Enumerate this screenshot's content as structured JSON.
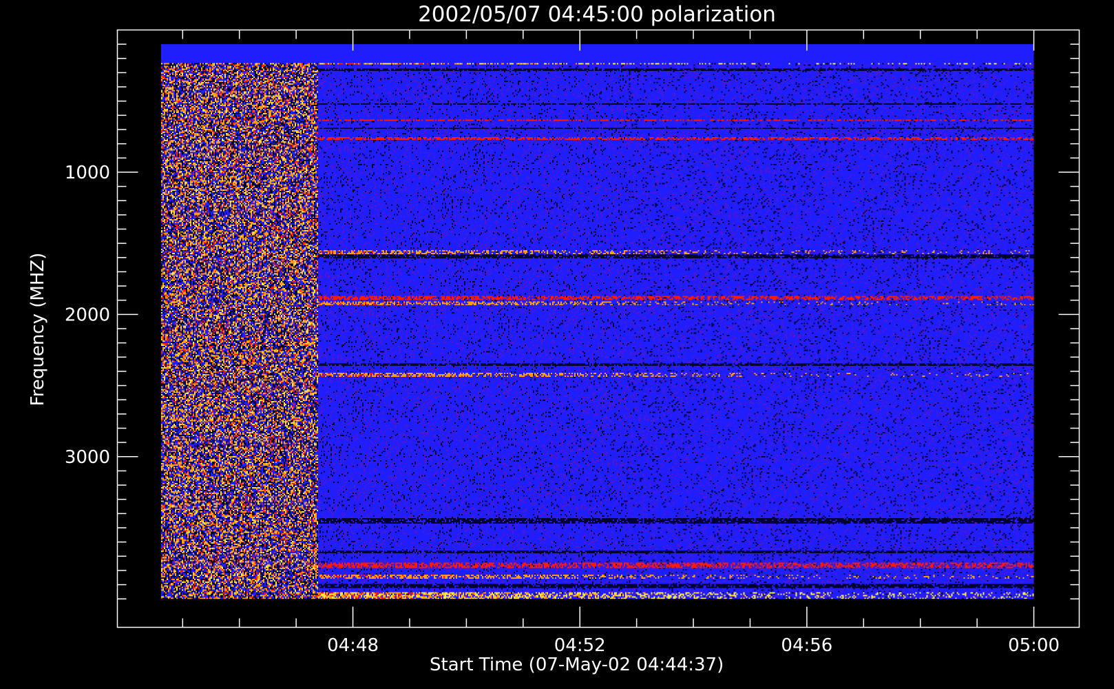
{
  "chart_data": {
    "type": "heatmap",
    "title": "2002/05/07 04:45:00 polarization",
    "xlabel": "Start Time (07-May-02 04:44:37)",
    "ylabel": "Frequency (MHZ)",
    "x_tick_labels": [
      "04:48",
      "04:52",
      "04:56",
      "05:00"
    ],
    "x_tick_values_min": [
      48,
      52,
      56,
      60
    ],
    "x_minor_step_min": 1,
    "x_range_min": [
      44.62,
      60.0
    ],
    "xlim_min": [
      43.85,
      60.8
    ],
    "y_tick_labels": [
      "1000",
      "2000",
      "3000"
    ],
    "y_tick_values": [
      1000,
      2000,
      3000
    ],
    "y_minor_step": 100,
    "y_range": [
      100,
      4000
    ],
    "ylim": [
      4200,
      0
    ],
    "colors": {
      "background": "#000000",
      "frame": "#ffffff",
      "base": "#1e1eff",
      "dark": "#000032",
      "red": "#ff1a00",
      "orange": "#ff9c1a",
      "yellow": "#ffe650"
    },
    "bands": [
      {
        "f0": 100,
        "f1": 230,
        "kind": "flat"
      },
      {
        "f0": 225,
        "f1": 235,
        "kind": "mixed"
      },
      {
        "f0": 270,
        "f1": 285,
        "kind": "dark"
      },
      {
        "f0": 515,
        "f1": 520,
        "kind": "dark"
      },
      {
        "f0": 625,
        "f1": 640,
        "kind": "red"
      },
      {
        "f0": 680,
        "f1": 695,
        "kind": "dark"
      },
      {
        "f0": 750,
        "f1": 770,
        "kind": "red"
      },
      {
        "f0": 1545,
        "f1": 1575,
        "kind": "orange"
      },
      {
        "f0": 1570,
        "f1": 1600,
        "kind": "dark"
      },
      {
        "f0": 1870,
        "f1": 1895,
        "kind": "red"
      },
      {
        "f0": 1910,
        "f1": 1935,
        "kind": "orange"
      },
      {
        "f0": 2340,
        "f1": 2365,
        "kind": "dark"
      },
      {
        "f0": 2410,
        "f1": 2440,
        "kind": "orange"
      },
      {
        "f0": 3440,
        "f1": 3470,
        "kind": "dark"
      },
      {
        "f0": 3660,
        "f1": 3680,
        "kind": "dark"
      },
      {
        "f0": 3750,
        "f1": 3790,
        "kind": "red"
      },
      {
        "f0": 3830,
        "f1": 3860,
        "kind": "orange"
      },
      {
        "f0": 3900,
        "f1": 3930,
        "kind": "dark"
      },
      {
        "f0": 3960,
        "f1": 4000,
        "kind": "mixed"
      }
    ]
  }
}
